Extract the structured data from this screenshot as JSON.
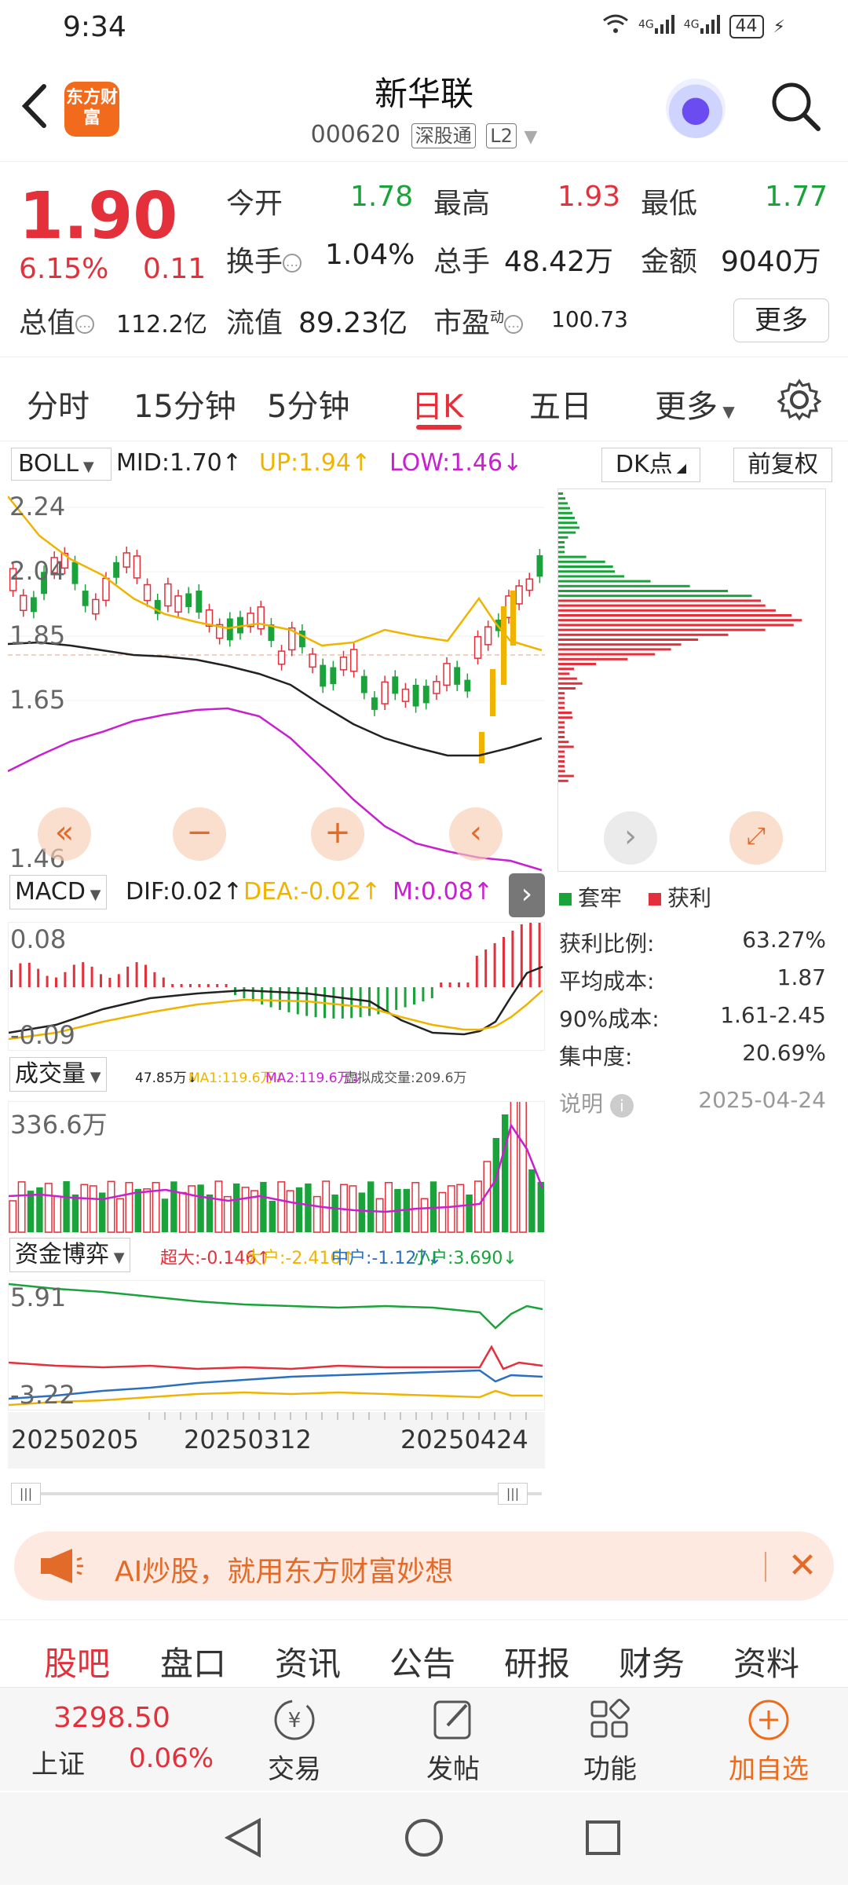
{
  "status_bar": {
    "time": "9:34",
    "net1": "4G",
    "net2": "4G",
    "battery": "44"
  },
  "header": {
    "logo_text": "东方财富",
    "name": "新华联",
    "code": "000620",
    "tag1": "深股通",
    "tag2": "L2"
  },
  "quote": {
    "price": "1.90",
    "pct": "6.15%",
    "change": "0.11",
    "open_label": "今开",
    "open": "1.78",
    "high_label": "最高",
    "high": "1.93",
    "low_label": "最低",
    "low": "1.77",
    "turnover_label": "换手",
    "turnover": "1.04%",
    "volume_label": "总手",
    "volume": "48.42万",
    "amount_label": "金额",
    "amount": "9040万",
    "mktcap_label": "总值",
    "mktcap": "112.2亿",
    "float_label": "流值",
    "float": "89.23亿",
    "pe_label": "市盈",
    "pe_sup": "动",
    "pe": "100.73",
    "more": "更多"
  },
  "period_tabs": [
    "分时",
    "15分钟",
    "5分钟",
    "日K",
    "五日",
    "更多"
  ],
  "active_period": "日K",
  "boll": {
    "select": "BOLL",
    "mid": "MID:1.70↑",
    "up": "UP:1.94↑",
    "low": "LOW:1.46↓",
    "dk_btn": "DK点",
    "fq_btn": "前复权"
  },
  "main_axis": {
    "top": "2.24",
    "y2": "2.04",
    "y3": "1.85",
    "y4": "1.65",
    "bottom": "1.46"
  },
  "macd": {
    "select": "MACD",
    "dif": "DIF:0.02↑",
    "dea": "DEA:-0.02↑",
    "m": "M:0.08↑",
    "axis_top": "0.08",
    "axis_bottom": "-0.09"
  },
  "volume": {
    "select": "成交量",
    "vol": "47.85万↓",
    "ma1": "MA1:119.6万↓",
    "ma2": "MA2:119.6万↓",
    "virtual": "虚拟成交量:209.6万",
    "axis_top": "336.6万"
  },
  "fund": {
    "select": "资金博弈",
    "super": "超大:-0.146↑",
    "large": "大户:-2.416↑",
    "mid": "中户:-1.127↓",
    "small": "小户:3.690↓",
    "axis_top": "5.91",
    "axis_bottom": "-3.22"
  },
  "dates": [
    "20250205",
    "20250312",
    "20250424"
  ],
  "dk_panel": {
    "legend_trap": "套牢",
    "legend_profit": "获利",
    "profit_ratio_label": "获利比例:",
    "profit_ratio": "63.27%",
    "avg_cost_label": "平均成本:",
    "avg_cost": "1.87",
    "cost90_label": "90%成本:",
    "cost90": "1.61-2.45",
    "concentration_label": "集中度:",
    "concentration": "20.69%",
    "note_label": "说明",
    "date": "2025-04-24"
  },
  "ai_banner": {
    "text": "AI炒股，就用东方财富妙想"
  },
  "content_tabs": [
    "股吧",
    "盘口",
    "资讯",
    "公告",
    "研报",
    "财务",
    "资料"
  ],
  "toolbar": {
    "index_value": "3298.50",
    "index_name": "上证",
    "index_pct": "0.06%",
    "trade": "交易",
    "post": "发帖",
    "function": "功能",
    "add": "加自选"
  },
  "colors": {
    "up": "#e3303b",
    "down": "#1aa33a",
    "accent": "#ee6b1a",
    "mid_line": "#222222",
    "up_line": "#f0b400",
    "low_line": "#c81fd0"
  }
}
